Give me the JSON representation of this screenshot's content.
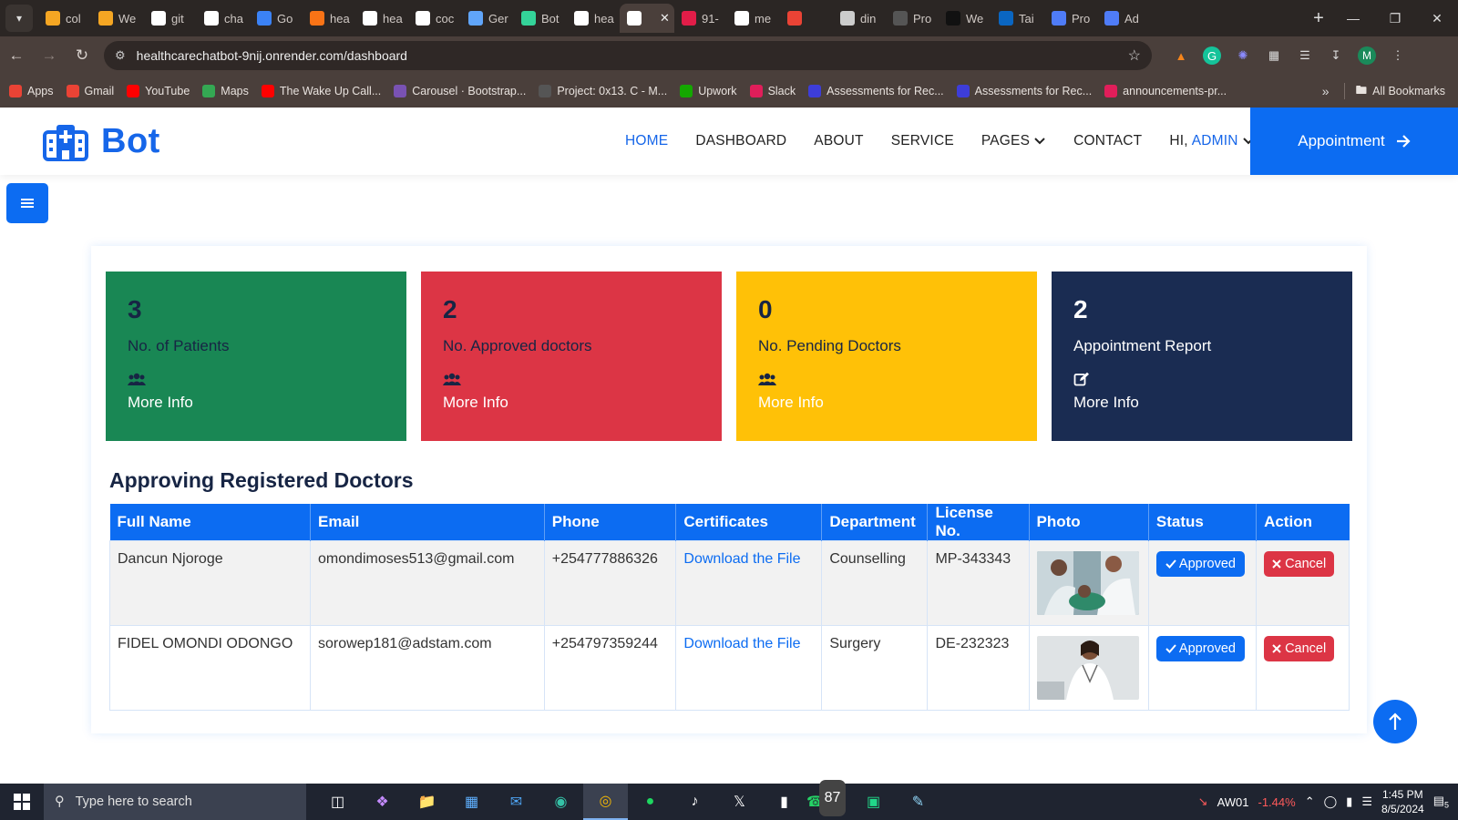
{
  "browser": {
    "tabs": [
      {
        "label": "col",
        "color": "#f5a623"
      },
      {
        "label": "We",
        "color": "#f5a623"
      },
      {
        "label": "git",
        "color": "#ffffff"
      },
      {
        "label": "cha",
        "color": "#ffffff"
      },
      {
        "label": "Go",
        "color": "#3b82f6"
      },
      {
        "label": "hea",
        "color": "#f97316"
      },
      {
        "label": "hea",
        "color": "#ffffff"
      },
      {
        "label": "coc",
        "color": "#ffffff"
      },
      {
        "label": "Ger",
        "color": "#60a5fa"
      },
      {
        "label": "Bot",
        "color": "#34d399"
      },
      {
        "label": "hea",
        "color": "#ffffff"
      },
      {
        "label": "",
        "color": "#ffffff",
        "active": true
      },
      {
        "label": "91-",
        "color": "#e11d48"
      },
      {
        "label": "me",
        "color": "#ffffff"
      },
      {
        "label": "",
        "color": "#ea4335"
      },
      {
        "label": "din",
        "color": "#cccccc"
      },
      {
        "label": "Pro",
        "color": "#555555"
      },
      {
        "label": "We",
        "color": "#111111"
      },
      {
        "label": "Tai",
        "color": "#0a66c2"
      },
      {
        "label": "Pro",
        "color": "#4f7cf7"
      },
      {
        "label": "Ad",
        "color": "#4f7cf7"
      }
    ],
    "url": "healthcarechatbot-9nij.onrender.com/dashboard",
    "profile_initial": "M",
    "bookmarks": [
      {
        "label": "Apps",
        "color": "#ea4335"
      },
      {
        "label": "Gmail",
        "color": "#ea4335"
      },
      {
        "label": "YouTube",
        "color": "#ff0000"
      },
      {
        "label": "Maps",
        "color": "#34a853"
      },
      {
        "label": "The Wake Up Call...",
        "color": "#ff0000"
      },
      {
        "label": "Carousel · Bootstrap...",
        "color": "#7952b3"
      },
      {
        "label": "Project: 0x13. C - M...",
        "color": "#555555"
      },
      {
        "label": "Upwork",
        "color": "#14a800"
      },
      {
        "label": "Slack",
        "color": "#e01e5a"
      },
      {
        "label": "Assessments for Rec...",
        "color": "#3d3dd9"
      },
      {
        "label": "Assessments for Rec...",
        "color": "#3d3dd9"
      },
      {
        "label": "announcements-pr...",
        "color": "#e01e5a"
      }
    ],
    "all_bookmarks": "All Bookmarks"
  },
  "site": {
    "brand": "Bot",
    "nav": [
      "HOME",
      "DASHBOARD",
      "ABOUT",
      "SERVICE",
      "PAGES",
      "CONTACT"
    ],
    "greeting": "HI,",
    "user": "ADMIN",
    "appointment": "Appointment"
  },
  "stats": [
    {
      "value": "3",
      "label": "No. of Patients",
      "more": "More Info"
    },
    {
      "value": "2",
      "label": "No. Approved doctors",
      "more": "More Info"
    },
    {
      "value": "0",
      "label": "No. Pending Doctors",
      "more": "More Info"
    },
    {
      "value": "2",
      "label": "Appointment Report",
      "more": "More Info"
    }
  ],
  "doctors": {
    "title": "Approving Registered Doctors",
    "columns": [
      "Full Name",
      "Email",
      "Phone",
      "Certificates",
      "Department",
      "License No.",
      "Photo",
      "Status",
      "Action"
    ],
    "rows": [
      {
        "name": "Dancun Njoroge",
        "email": "omondimoses513@gmail.com",
        "phone": "+254777886326",
        "certificate": "Download the File",
        "department": "Counselling",
        "license": "MP-343343",
        "status": "Approved",
        "action": "Cancel"
      },
      {
        "name": "FIDEL OMONDI ODONGO",
        "email": "sorowep181@adstam.com",
        "phone": "+254797359244",
        "certificate": "Download the File",
        "department": "Surgery",
        "license": "DE-232323",
        "status": "Approved",
        "action": "Cancel"
      }
    ]
  },
  "taskbar": {
    "search_placeholder": "Type here to search",
    "whatsapp_badge": "87",
    "stock": {
      "symbol": "AW01",
      "change": "-1.44%"
    },
    "time": "1:45 PM",
    "date": "8/5/2024",
    "notifications": "5"
  }
}
